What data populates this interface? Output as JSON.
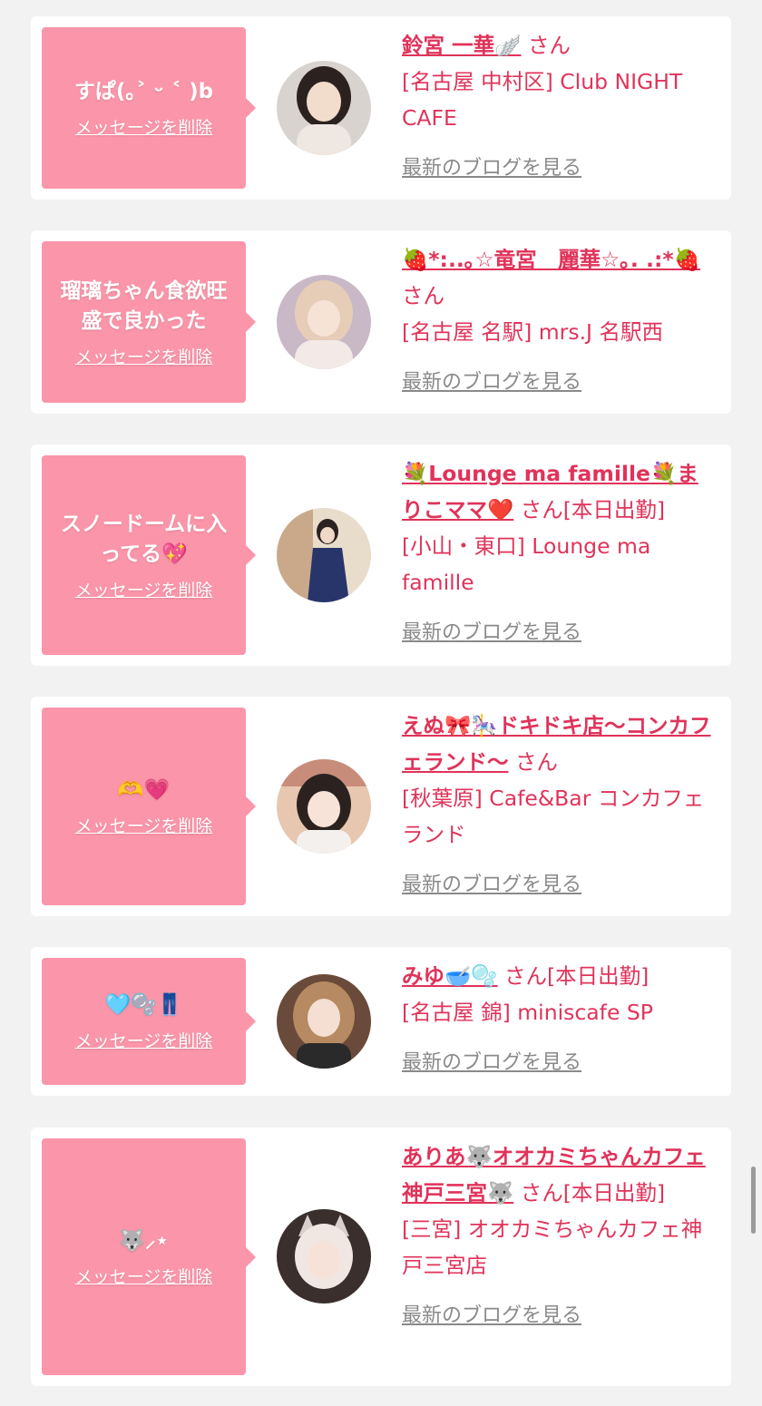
{
  "delete_label": "メッセージを削除",
  "blog_label": "最新のブログを見る",
  "san": "さん",
  "working_today": "[本日出勤]",
  "colors": {
    "background": "#f2f2f2",
    "bubble": "#fb96aa",
    "accent": "#e0335a",
    "blog_link": "#8a8a8a"
  },
  "cards": [
    {
      "message": "すぱ(｡˃ ᵕ ˂ )b",
      "name": "鈴宮 一華🪽",
      "working": "",
      "shop": "[名古屋 中村区] Club NIGHT CAFE"
    },
    {
      "message": "瑠璃ちゃん食欲旺盛で良かった",
      "name": "🍓*:..｡☆竜宮　麗華☆｡. .:*🍓",
      "working": "",
      "shop": "[名古屋 名駅] mrs.J 名駅西"
    },
    {
      "message": "スノードームに入ってる💖",
      "name": "💐Lounge ma famille💐まりこママ❤️",
      "working": "[本日出勤]",
      "shop": "[小山・東口] Lounge ma famille"
    },
    {
      "message": "🫶💗",
      "name": "えぬ🎀🎠ドキドキ店〜コンカフェランド〜",
      "working": "",
      "shop": "[秋葉原] Cafe&Bar コンカフェランド"
    },
    {
      "message": "🩵🫧👖",
      "name": "みゆ🥣🫧",
      "working": "[本日出勤]",
      "shop": "[名古屋 錦] miniscafe SP"
    },
    {
      "message": "🐺⸝⋆",
      "name": "ありあ🐺オオカミちゃんカフェ神戸三宮🐺",
      "working": "[本日出勤]",
      "shop": "[三宮] オオカミちゃんカフェ神戸三宮店"
    }
  ]
}
